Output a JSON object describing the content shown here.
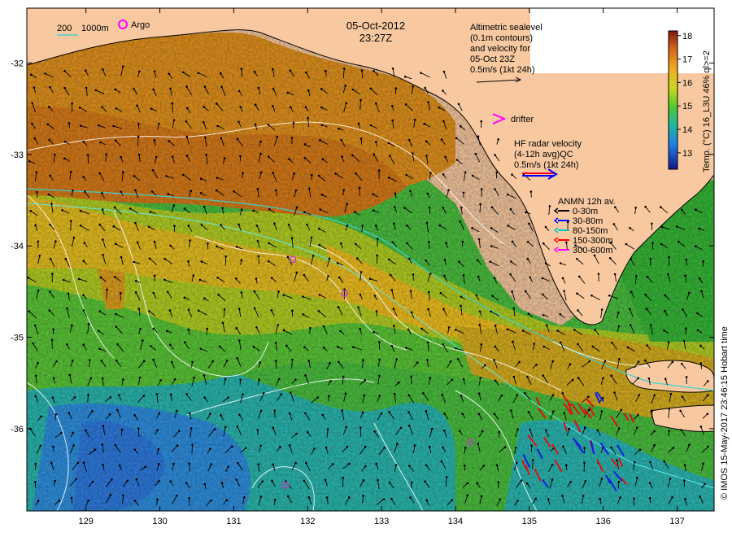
{
  "title": {
    "date": "05-Oct-2012",
    "time": "23:27Z"
  },
  "depth_legend": {
    "label_200": "200",
    "label_1000": "1000m",
    "argo_label": "Argo"
  },
  "altimetry": {
    "line1": "Altimetric sealevel",
    "line2": "(0.1m contours)",
    "line3": "and velocity for",
    "line4": "05-Oct 23Z",
    "line5": "0.5m/s (1kt 24h)"
  },
  "drifter": {
    "label": "drifter",
    "color": "#ff00ff"
  },
  "hf_radar": {
    "line1": "HF radar velocity",
    "line2": "(4-12h avg)QC",
    "line3": "0.5m/s (1kt 24h)"
  },
  "anmn": {
    "title": "ANMN 12h av.",
    "items": [
      {
        "label": "0-30m",
        "color": "#000000"
      },
      {
        "label": "30-80m",
        "color": "#0000ff"
      },
      {
        "label": "80-150m",
        "color": "#00c8c8"
      },
      {
        "label": "150-300m",
        "color": "#ff0000"
      },
      {
        "label": "300-600m",
        "color": "#ff00ff"
      }
    ]
  },
  "colorbar": {
    "title": "Temp. (°C) 16_L3U 46% ql>=2",
    "ticks": [
      "18",
      "17",
      "16",
      "15",
      "14",
      "13"
    ],
    "range": [
      12.3,
      18.2
    ]
  },
  "credit": "© IMOS 15-May-2017 23:46:15 Hobart time",
  "axes": {
    "x_ticks": [
      "129",
      "130",
      "131",
      "132",
      "133",
      "134",
      "135",
      "136",
      "137"
    ],
    "y_ticks": [
      "-32",
      "-33",
      "-34",
      "-35",
      "-36"
    ],
    "lon_range": [
      128.2,
      137.5
    ],
    "lat_range": [
      -36.9,
      -31.4
    ]
  },
  "argo_floats": [
    {
      "lon": 131.8,
      "lat": -34.15
    },
    {
      "lon": 132.5,
      "lat": -34.52
    },
    {
      "lon": 134.2,
      "lat": -36.15
    },
    {
      "lon": 131.7,
      "lat": -36.62
    }
  ],
  "colors": {
    "land": "#f8c9a0",
    "warm": "#e08a1e",
    "mid": "#a6cc2a",
    "cool": "#22b8b0",
    "cold": "#2a7fd4",
    "contour": "#ffffff",
    "isobath_200": "#40d0d0",
    "isobath_1000": "#60e8e8"
  }
}
